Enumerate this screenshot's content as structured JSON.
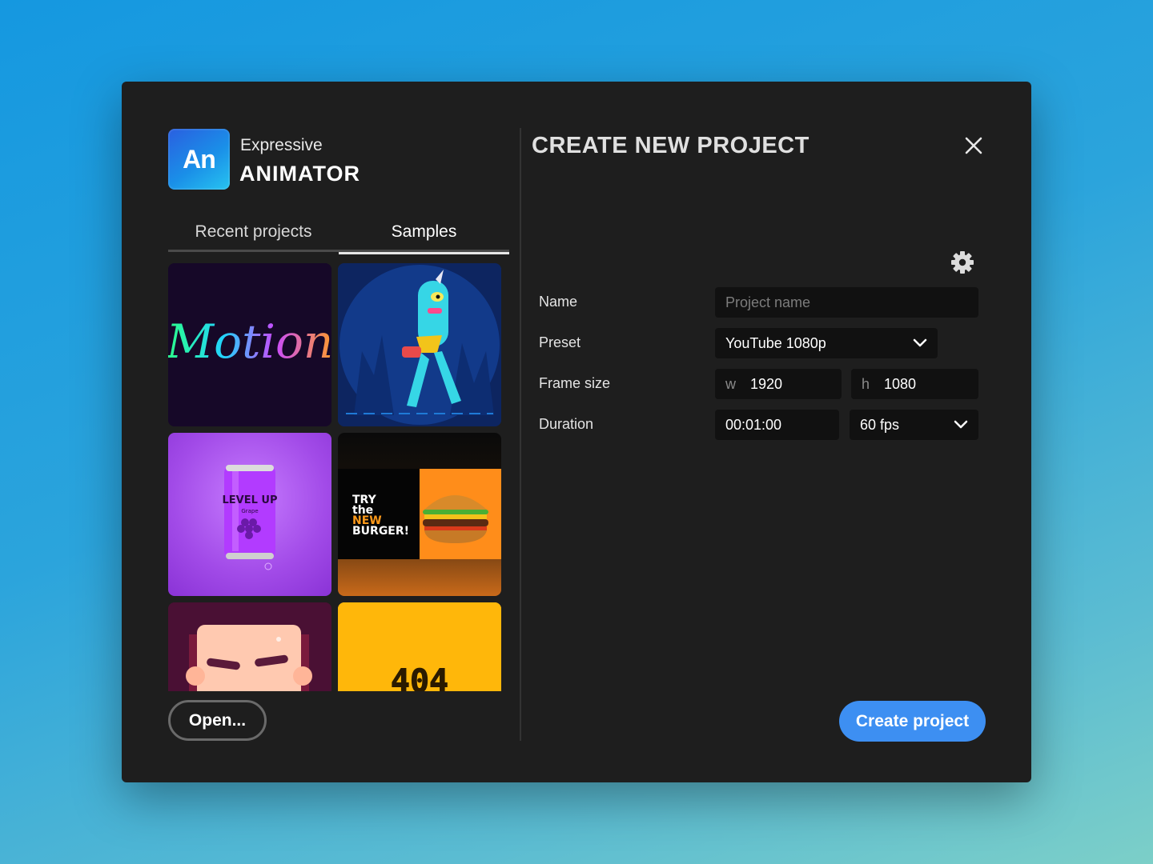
{
  "app": {
    "logo_text": "An",
    "brand_top": "Expressive",
    "brand_main": "ANIMATOR"
  },
  "tabs": [
    {
      "label": "Recent projects",
      "active": false
    },
    {
      "label": "Samples",
      "active": true
    }
  ],
  "samples": [
    {
      "name": "Motion",
      "text": "Motion"
    },
    {
      "name": "Unicorn character walk"
    },
    {
      "name": "Level Up soda can",
      "text": "LEVEL UP",
      "sub": "Grape"
    },
    {
      "name": "Burger ad",
      "lines": [
        "TRY",
        "the",
        "NEW",
        "BURGER!"
      ]
    },
    {
      "name": "Cartoon face"
    },
    {
      "name": "404",
      "text": "404"
    }
  ],
  "open_button": "Open...",
  "dialog": {
    "title": "CREATE NEW PROJECT",
    "fields": {
      "name_label": "Name",
      "name_placeholder": "Project name",
      "name_value": "",
      "preset_label": "Preset",
      "preset_value": "YouTube 1080p",
      "frame_label": "Frame size",
      "width_prefix": "w",
      "width_value": "1920",
      "height_prefix": "h",
      "height_value": "1080",
      "duration_label": "Duration",
      "duration_value": "00:01:00",
      "fps_value": "60 fps"
    },
    "create_button": "Create project"
  },
  "colors": {
    "accent": "#3d8ff2",
    "dialog_bg": "#1e1e1e",
    "field_bg": "#111111"
  },
  "icons": [
    "close-icon",
    "chevron-down-icon",
    "gear-icon"
  ]
}
